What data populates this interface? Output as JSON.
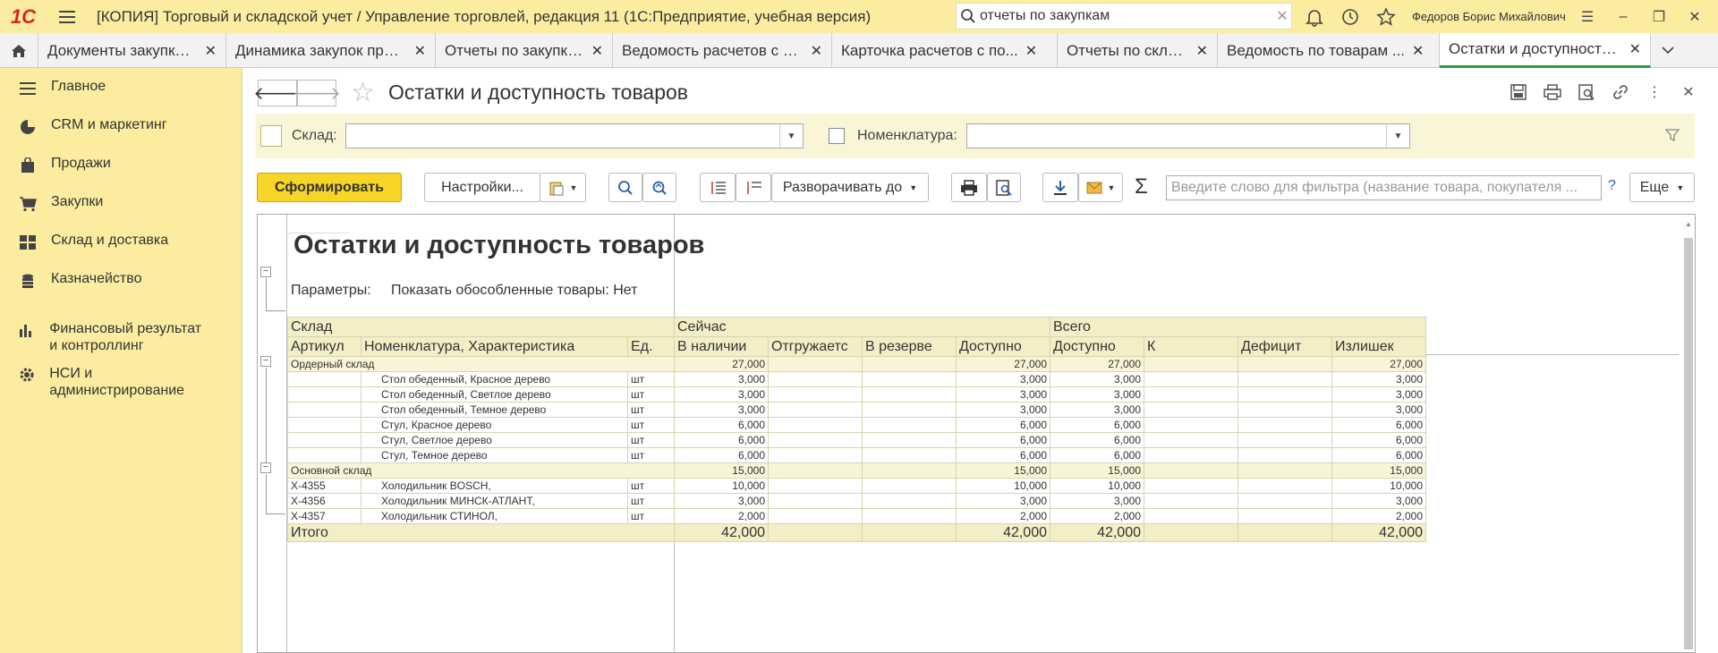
{
  "app": {
    "logo": "1С",
    "title": "[КОПИЯ] Торговый и складской учет / Управление торговлей, редакция 11  (1С:Предприятие, учебная версия)",
    "search_value": "отчеты по закупкам",
    "user": "Федоров Борис Михайлович"
  },
  "tabs": [
    {
      "label": "Документы закупки (все)"
    },
    {
      "label": "Динамика закупок пред..."
    },
    {
      "label": "Отчеты по закупкам"
    },
    {
      "label": "Ведомость расчетов с п..."
    },
    {
      "label": "Карточка расчетов с по..."
    },
    {
      "label": "Отчеты по складу"
    },
    {
      "label": "Ведомость по товарам ..."
    },
    {
      "label": "Остатки и доступность ..."
    }
  ],
  "sidebar": {
    "items": [
      {
        "label": "Главное",
        "icon": "menu-icon"
      },
      {
        "label": "CRM и маркетинг",
        "icon": "pie-chart-icon"
      },
      {
        "label": "Продажи",
        "icon": "bag-icon"
      },
      {
        "label": "Закупки",
        "icon": "cart-icon"
      },
      {
        "label": "Склад и доставка",
        "icon": "grid-icon"
      },
      {
        "label": "Казначейство",
        "icon": "coins-icon"
      },
      {
        "label": "Финансовый результат и контроллинг",
        "icon": "bar-chart-icon"
      },
      {
        "label": "НСИ и администрирование",
        "icon": "gear-icon"
      }
    ]
  },
  "page": {
    "title": "Остатки и доступность товаров"
  },
  "filters": {
    "warehouse_label": "Склад:",
    "warehouse_value": "",
    "nomenclature_label": "Номенклатура:",
    "nomenclature_value": ""
  },
  "toolbar": {
    "generate_label": "Сформировать",
    "settings_label": "Настройки...",
    "expand_label": "Разворачивать до",
    "sum_symbol": "Σ",
    "filter_placeholder": "Введите слово для фильтра (название товара, покупателя ...",
    "help": "?",
    "more_label": "Еще"
  },
  "report": {
    "title": "Остатки и доступность товаров",
    "params_label": "Параметры:",
    "params_value": "Показать обособленные товары: Нет",
    "header1": {
      "warehouse": "Склад",
      "now": "Сейчас",
      "total": "Всего"
    },
    "header2": {
      "article": "Артикул",
      "nomenclature": "Номенклатура, Характеристика",
      "unit": "Ед.",
      "on_hand": "В наличии",
      "shipping": "Отгружаетс",
      "reserved": "В резерве",
      "available_now": "Доступно",
      "available_total": "Доступно",
      "k": "К",
      "deficit": "Дефицит",
      "surplus": "Излишек"
    },
    "groups": [
      {
        "name": "Ордерный склад",
        "on_hand": "27,000",
        "available_now": "27,000",
        "available_total": "27,000",
        "surplus": "27,000",
        "rows": [
          {
            "article": "",
            "name": "Стол обеденный, Красное дерево",
            "unit": "шт",
            "on_hand": "3,000",
            "available_now": "3,000",
            "available_total": "3,000",
            "surplus": "3,000"
          },
          {
            "article": "",
            "name": "Стол обеденный, Светлое дерево",
            "unit": "шт",
            "on_hand": "3,000",
            "available_now": "3,000",
            "available_total": "3,000",
            "surplus": "3,000"
          },
          {
            "article": "",
            "name": "Стол обеденный, Темное дерево",
            "unit": "шт",
            "on_hand": "3,000",
            "available_now": "3,000",
            "available_total": "3,000",
            "surplus": "3,000"
          },
          {
            "article": "",
            "name": "Стул, Красное дерево",
            "unit": "шт",
            "on_hand": "6,000",
            "available_now": "6,000",
            "available_total": "6,000",
            "surplus": "6,000"
          },
          {
            "article": "",
            "name": "Стул, Светлое дерево",
            "unit": "шт",
            "on_hand": "6,000",
            "available_now": "6,000",
            "available_total": "6,000",
            "surplus": "6,000"
          },
          {
            "article": "",
            "name": "Стул, Темное дерево",
            "unit": "шт",
            "on_hand": "6,000",
            "available_now": "6,000",
            "available_total": "6,000",
            "surplus": "6,000"
          }
        ]
      },
      {
        "name": "Основной склад",
        "on_hand": "15,000",
        "available_now": "15,000",
        "available_total": "15,000",
        "surplus": "15,000",
        "rows": [
          {
            "article": "X-4355",
            "name": "Холодильник BOSCH,",
            "unit": "шт",
            "on_hand": "10,000",
            "available_now": "10,000",
            "available_total": "10,000",
            "surplus": "10,000"
          },
          {
            "article": "X-4356",
            "name": "Холодильник МИНСК-АТЛАНТ,",
            "unit": "шт",
            "on_hand": "3,000",
            "available_now": "3,000",
            "available_total": "3,000",
            "surplus": "3,000"
          },
          {
            "article": "X-4357",
            "name": "Холодильник СТИНОЛ,",
            "unit": "шт",
            "on_hand": "2,000",
            "available_now": "2,000",
            "available_total": "2,000",
            "surplus": "2,000"
          }
        ]
      }
    ],
    "total": {
      "label": "Итого",
      "on_hand": "42,000",
      "available_now": "42,000",
      "available_total": "42,000",
      "surplus": "42,000"
    }
  }
}
